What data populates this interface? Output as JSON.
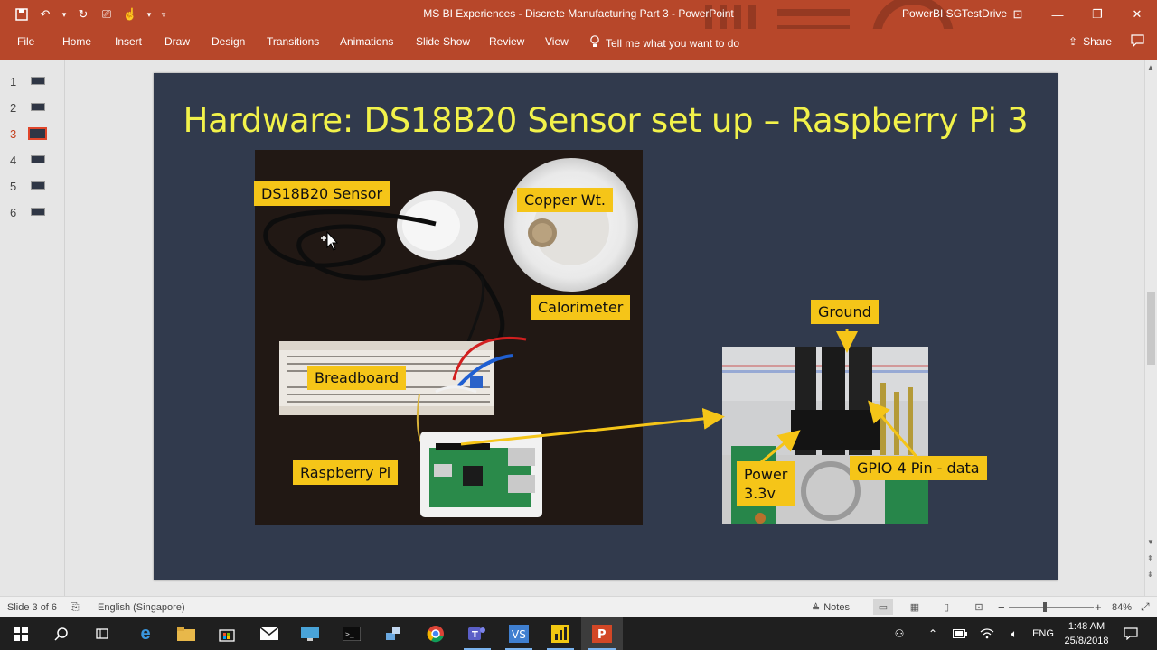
{
  "window": {
    "title": "MS BI Experiences - Discrete Manufacturing Part 3  -  PowerPoint",
    "account": "PowerBI SGTestDrive",
    "qat": [
      "save-icon",
      "undo-icon",
      "redo-icon",
      "present-icon",
      "touch-icon",
      "customize-icon"
    ],
    "controls": {
      "ribbon_display": "⊡",
      "minimize": "—",
      "restore": "❐",
      "close": "✕"
    }
  },
  "ribbon": {
    "tabs": [
      "File",
      "Home",
      "Insert",
      "Draw",
      "Design",
      "Transitions",
      "Animations",
      "Slide Show",
      "Review",
      "View"
    ],
    "tell_me": "Tell me what you want to do",
    "share": "Share"
  },
  "thumbnails": {
    "items": [
      {
        "number": "1"
      },
      {
        "number": "2"
      },
      {
        "number": "3",
        "active": true
      },
      {
        "number": "4"
      },
      {
        "number": "5"
      },
      {
        "number": "6"
      }
    ]
  },
  "slide": {
    "title": "Hardware: DS18B20 Sensor set up – Raspberry Pi 3",
    "labels": {
      "sensor": "DS18B20 Sensor",
      "copper": "Copper Wt.",
      "calorimeter": "Calorimeter",
      "breadboard": "Breadboard",
      "raspberry": "Raspberry Pi",
      "ground": "Ground",
      "power_line1": "Power",
      "power_line2": "3.3v",
      "gpio": "GPIO 4 Pin - data"
    },
    "colors": {
      "background": "#313a4d",
      "title": "#f2f24a",
      "label_fill": "#f5c518",
      "arrow": "#f5c518"
    }
  },
  "status": {
    "slide_info": "Slide 3 of 6",
    "language": "English (Singapore)",
    "notes": "Notes",
    "zoom": "84%",
    "zoom_level_percent": 84
  },
  "taskbar": {
    "apps": [
      "start-icon",
      "search-icon",
      "task-view-icon",
      "edge-icon",
      "file-explorer-icon",
      "store-icon",
      "mail-icon",
      "remote-desktop-icon",
      "terminal-icon",
      "network-tool-icon",
      "chrome-icon",
      "teams-icon",
      "visual-studio-code-icon",
      "power-bi-icon",
      "powerpoint-icon"
    ],
    "tray_language": "ENG",
    "time": "1:48 AM",
    "date": "25/8/2018"
  }
}
